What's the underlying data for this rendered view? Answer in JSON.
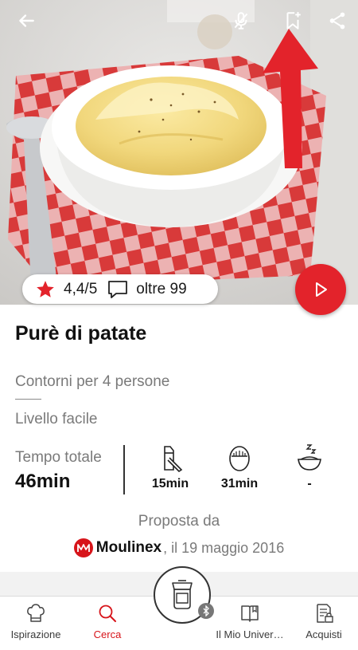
{
  "header": {
    "back_icon": "arrow-left-icon",
    "mic_icon": "mic-off-icon",
    "bookmark_icon": "bookmark-add-icon",
    "share_icon": "share-icon"
  },
  "recipe": {
    "rating": "4,4/5",
    "comments": "oltre 99",
    "title": "Purè di patate",
    "category": "Contorni per 4 persone",
    "difficulty": "Livello facile",
    "time_total_label": "Tempo totale",
    "time_total_value": "46min",
    "prep_time": "15min",
    "cook_time": "31min",
    "rest_time": "-",
    "proposed_by_label": "Proposta da",
    "brand": "Moulinex",
    "date": ", il 19 maggio 2016"
  },
  "nav": {
    "items": [
      {
        "label": "Ispirazione",
        "icon": "chef-hat-icon"
      },
      {
        "label": "Cerca",
        "icon": "search-icon"
      },
      {
        "label": "Il Mio Univer…",
        "icon": "book-icon"
      },
      {
        "label": "Acquisti",
        "icon": "shopping-list-icon"
      }
    ],
    "active_index": 1,
    "device_icon": "cooking-device-icon"
  },
  "colors": {
    "accent": "#e3232b",
    "brand_red": "#d7141a",
    "text_gray": "#7a7a7a"
  }
}
